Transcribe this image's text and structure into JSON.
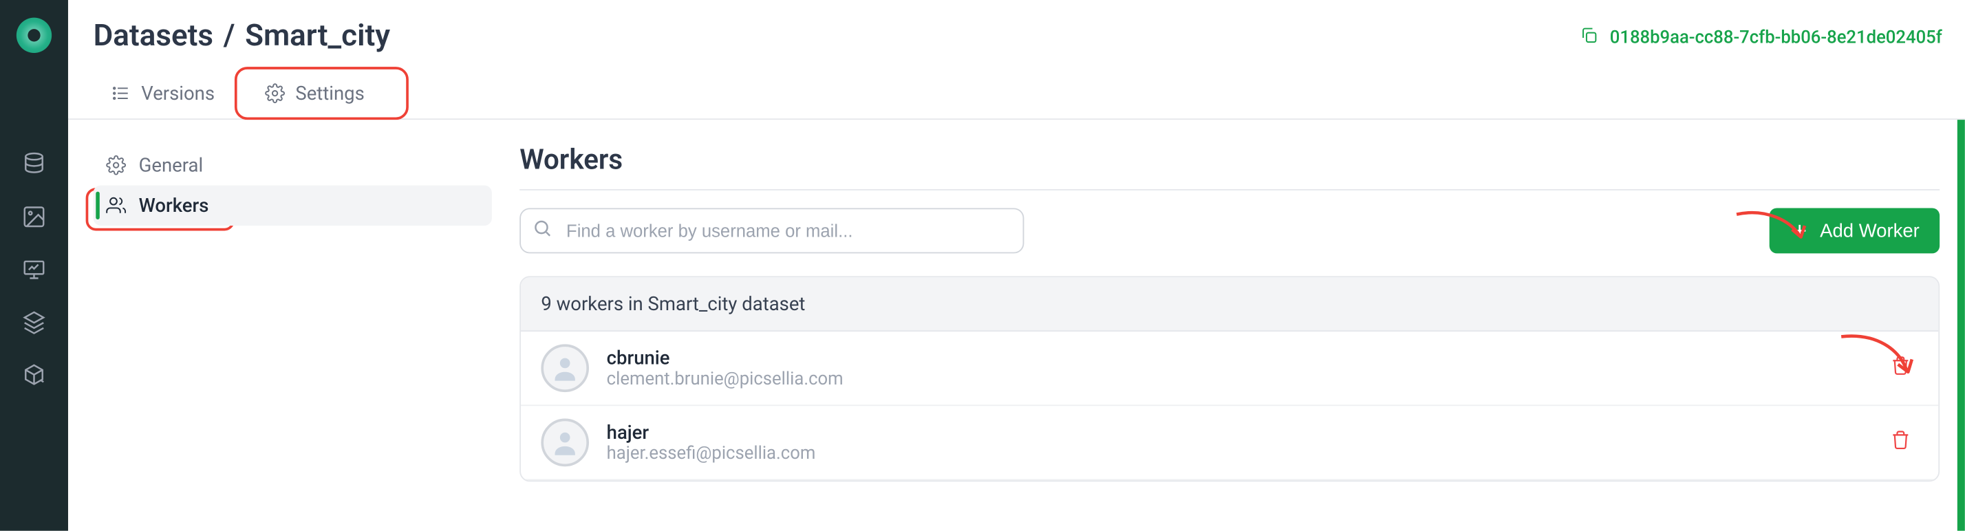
{
  "breadcrumb": {
    "root": "Datasets",
    "sep": "/",
    "current": "Smart_city"
  },
  "uuid": "0188b9aa-cc88-7cfb-bb06-8e21de02405f",
  "tabs": {
    "versions": "Versions",
    "settings": "Settings"
  },
  "sidebar": {
    "general": "General",
    "workers": "Workers"
  },
  "main": {
    "title": "Workers",
    "search_placeholder": "Find a worker by username or mail...",
    "add_button": "Add Worker",
    "list_header": "9 workers in Smart_city dataset"
  },
  "workers": [
    {
      "username": "cbrunie",
      "email": "clement.brunie@picsellia.com"
    },
    {
      "username": "hajer",
      "email": "hajer.essefi@picsellia.com"
    }
  ]
}
